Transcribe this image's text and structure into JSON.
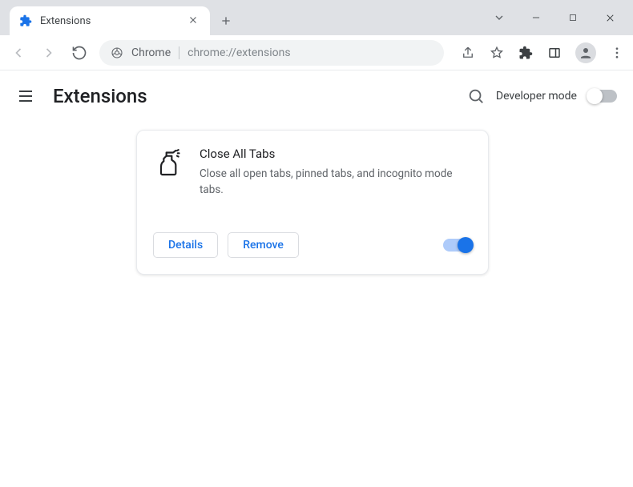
{
  "titlebar": {
    "tab_title": "Extensions"
  },
  "toolbar": {
    "addr_prefix": "Chrome",
    "addr_url": "chrome://extensions"
  },
  "page": {
    "title": "Extensions",
    "developer_mode_label": "Developer mode",
    "developer_mode_on": false
  },
  "extension": {
    "name": "Close All Tabs",
    "description": "Close all open tabs, pinned tabs, and incognito mode tabs.",
    "details_label": "Details",
    "remove_label": "Remove",
    "enabled": true
  }
}
